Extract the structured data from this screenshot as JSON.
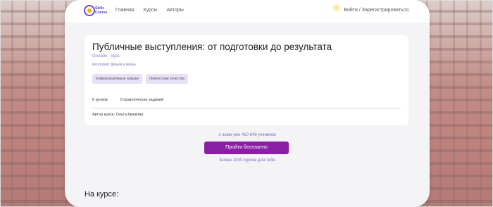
{
  "nav": {
    "logo_text": "Skills Course",
    "links": [
      "Главная",
      "Курсы",
      "Авторы"
    ],
    "auth": "Войти / Зарегистрироваться"
  },
  "course": {
    "title": "Публичные выступления: от подготовки до результата",
    "format": "Онлайн - курс",
    "category": "Категория: Деньги и жизнь",
    "tags": [
      "Коммуникативные навыки",
      "Личностные качества"
    ],
    "lessons": "6 уроков",
    "tasks": "5 практических заданий",
    "author": "Автор курса: Ольга Крюкова"
  },
  "cta": {
    "students": "с нами уже 410 849 учеников",
    "button": "Пройти бесплатно",
    "more": "Более 1000 курсов для тебя"
  },
  "section": {
    "title": "На курсе:"
  },
  "colors": {
    "accent": "#8a1fa5",
    "link": "#7b6ec3",
    "tag_bg": "#e6e1f7"
  }
}
